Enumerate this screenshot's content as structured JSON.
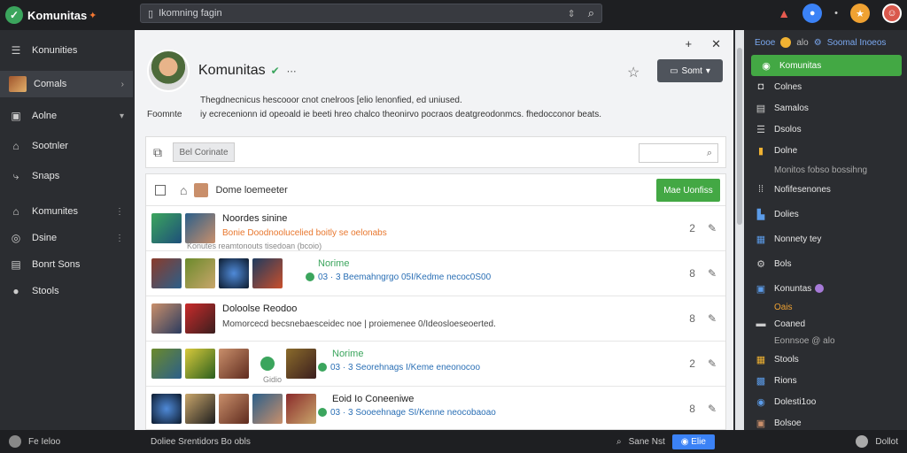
{
  "app": {
    "name": "Komunitas",
    "logo_icon": "shield-logo",
    "accent": "#3ba55d"
  },
  "search": {
    "value": "Ikomning fagin",
    "icon": "search-icon"
  },
  "sidebar": {
    "items": [
      {
        "label": "Konunities",
        "icon": "list-icon",
        "extra": ""
      },
      {
        "label": "Comals",
        "icon": "game-thumb",
        "extra": "›",
        "active": true
      },
      {
        "label": "Aolne",
        "icon": "chat-icon",
        "extra": "▾"
      },
      {
        "label": "Sootnler",
        "icon": "home-icon",
        "extra": ""
      },
      {
        "label": "Snaps",
        "icon": "share-icon",
        "extra": ""
      },
      {
        "label": "Komunites",
        "icon": "home-icon",
        "extra": "⋮"
      },
      {
        "label": "Dsine",
        "icon": "globe-icon",
        "extra": "⋮"
      },
      {
        "label": "Bonrt Sons",
        "icon": "grid-icon",
        "extra": ""
      },
      {
        "label": "Stools",
        "icon": "dot-icon",
        "extra": ""
      }
    ]
  },
  "profile": {
    "name": "Komunitas",
    "star_icon": "star-icon",
    "join_label": "Somt",
    "desc_label": "Foomnte",
    "desc_line1": "Thegdnecnicus hescooor cnot cnelroos [elio lenonfied, ed uniused.",
    "desc_line2": "iy ecrecenionn id opeoald ie beeti hreo chalco theonirvo pocraos deatgreodonmcs. fhedocconor beats."
  },
  "toolbar": {
    "button_label": "Bel Corinate",
    "search_placeholder": ""
  },
  "list": {
    "header_label": "Dome loemeeter",
    "header_button": "Mae Uonfiss",
    "rows": [
      {
        "title": "Noordes sinine",
        "sub": "Bonie Doodnoolucelied boitly se oelonabs",
        "meta": "Konutes reamtonouts tisedoan (bcoio)",
        "count": "2"
      },
      {
        "title": "Norime",
        "sub": "03 · 3  Beemahngrgo 05I/Kedme necoc0S00",
        "meta": "",
        "count": "8",
        "status": true
      },
      {
        "title": "Doloolse Reodoo",
        "sub": "Momorcecd becsnebaesceidec noe | proiemenee 0/Ideosloeseoerted.",
        "meta": "",
        "count": "8"
      },
      {
        "title": "Norime",
        "sub": "03 · 3  Seorehnags I/Keme eneonocoo",
        "meta": "Gidio",
        "count": "2",
        "status": true
      },
      {
        "title": "Eoid Io Coneeniwe",
        "sub": "03 · 3  Sooeehnage SI/Kenne neocobaoao",
        "meta": "",
        "count": "8",
        "status": true
      }
    ]
  },
  "right_panel": {
    "top_left": "Eooe",
    "top_mid": "alo",
    "top_right": "Soomal Inoeos",
    "items": [
      {
        "label": "Komunitas",
        "active": true,
        "icon": "shield-icon"
      },
      {
        "label": "Colnes",
        "icon": "game-icon"
      },
      {
        "label": "Samalos",
        "icon": "list-icon"
      },
      {
        "label": "Dsolos",
        "icon": "list-icon"
      },
      {
        "label": "Dolne",
        "icon": "folder-icon"
      },
      {
        "label": "Monitos fobso bossihng",
        "sub": true,
        "icon": ""
      },
      {
        "label": "Nofifesenones",
        "icon": "grid-icon"
      },
      {
        "label": "Dolies",
        "icon": "chart-icon"
      },
      {
        "label": "Nonnety tey",
        "icon": "grid-icon"
      },
      {
        "label": "Bols",
        "icon": "gear-icon"
      },
      {
        "label": "Konuntas",
        "icon": "grid-icon"
      },
      {
        "label": "Oais",
        "orange": true,
        "icon": ""
      },
      {
        "label": "Coaned",
        "icon": "chat-icon"
      },
      {
        "label": "Eonnsoe @ alo",
        "sub": true,
        "icon": ""
      },
      {
        "label": "Stools",
        "icon": "grid-icon"
      },
      {
        "label": "Rions",
        "icon": "image-icon"
      },
      {
        "label": "Dolesti1oo",
        "icon": "globe-icon"
      },
      {
        "label": "Bolsoe",
        "icon": "game-icon"
      }
    ]
  },
  "bottom": {
    "left": "Fe Ieloo",
    "mid": "Doliee  Srentidors  Bo obls",
    "right_label": "Sane Nst",
    "right_button": "Elie",
    "far_right": "Dollot"
  }
}
